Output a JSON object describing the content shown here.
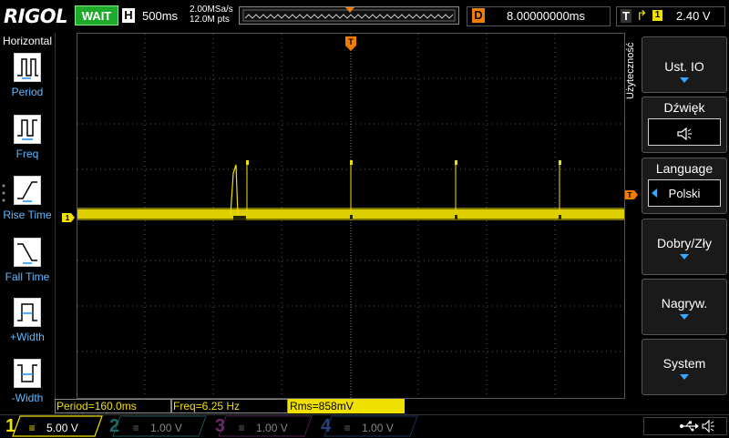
{
  "app": {
    "logo": "RIGOL",
    "run_state": "WAIT"
  },
  "horizontal": {
    "letter": "H",
    "timebase": "500ms",
    "sample_rate": "2.00MSa/s",
    "points": "12.0M pts"
  },
  "delay": {
    "letter": "D",
    "value": "8.00000000ms"
  },
  "trigger": {
    "letter": "T",
    "source": "1",
    "slope_icon": "rising-edge-icon",
    "level": "2.40 V",
    "marker_label": "T"
  },
  "left_menu": {
    "title": "Horizontal",
    "items": [
      {
        "label": "Period",
        "icon": "period-icon"
      },
      {
        "label": "Freq",
        "icon": "freq-icon"
      },
      {
        "label": "Rise Time",
        "icon": "rise-time-icon"
      },
      {
        "label": "Fall Time",
        "icon": "fall-time-icon"
      },
      {
        "label": "+Width",
        "icon": "pos-width-icon"
      },
      {
        "label": "-Width",
        "icon": "neg-width-icon"
      }
    ]
  },
  "right_menu": {
    "title": "Użyteczność",
    "items": [
      {
        "label": "Ust. IO"
      },
      {
        "label": "Dźwięk",
        "value_icon": "speaker-icon"
      },
      {
        "label": "Language",
        "value": "Polski"
      },
      {
        "label": "Dobry/Zły"
      },
      {
        "label": "Nagryw."
      },
      {
        "label": "System"
      }
    ]
  },
  "measurements": [
    {
      "text": "Period=160.0ms"
    },
    {
      "text": "Freq=6.25 Hz"
    },
    {
      "text": "Rms=858mV"
    }
  ],
  "channels": [
    {
      "num": "1",
      "scale": "5.00 V",
      "color": "#f0e000",
      "active": true
    },
    {
      "num": "2",
      "scale": "1.00 V",
      "color": "#00c8c8",
      "active": false
    },
    {
      "num": "3",
      "scale": "1.00 V",
      "color": "#e040e0",
      "active": false
    },
    {
      "num": "4",
      "scale": "1.00 V",
      "color": "#2f7bff",
      "active": false
    }
  ],
  "ch1_marker": "1",
  "status_icons": [
    "usb-icon",
    "speaker-icon"
  ],
  "colors": {
    "ch1": "#f0e000",
    "trigger": "#f07d00",
    "menu_accent": "#35a7ff",
    "run_state": "#1faa2c"
  }
}
